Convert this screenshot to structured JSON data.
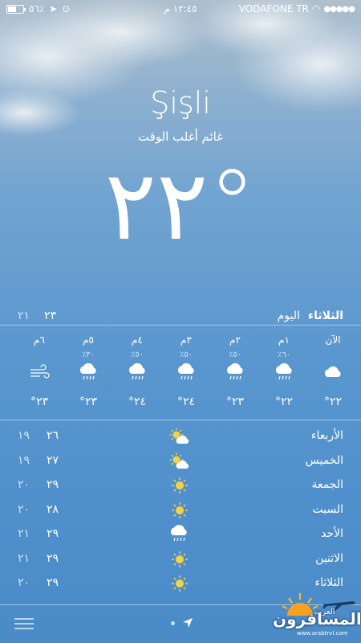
{
  "status_bar": {
    "battery_text": "٥٦٪",
    "battery_level": 0.56,
    "time": "١٢:٤٥ م",
    "carrier": "VODAFONE TR",
    "signal_dots": "●●●●●"
  },
  "location": {
    "city": "Şişli",
    "condition": "غائم أغلب الوقت",
    "temperature": "٢٢°"
  },
  "today": {
    "day": "الثلاثاء",
    "label": "اليوم",
    "high": "٢٣",
    "low": "٢١"
  },
  "hourly": [
    {
      "time": "الآن",
      "pop": "",
      "icon": "cloud-icon",
      "temp": "٢٢°"
    },
    {
      "time": "١م",
      "pop": "٦٠٪",
      "icon": "rain-cloud-icon",
      "temp": "٢٢°"
    },
    {
      "time": "٢م",
      "pop": "٥٠٪",
      "icon": "rain-cloud-icon",
      "temp": "٢٣°"
    },
    {
      "time": "٣م",
      "pop": "٥٠٪",
      "icon": "rain-cloud-icon",
      "temp": "٢٤°"
    },
    {
      "time": "٤م",
      "pop": "٥٠٪",
      "icon": "rain-cloud-icon",
      "temp": "٢٤°"
    },
    {
      "time": "٥م",
      "pop": "٣٠٪",
      "icon": "rain-cloud-icon",
      "temp": "٢٣°"
    },
    {
      "time": "٦م",
      "pop": "",
      "icon": "wind-icon",
      "temp": "٢٣°"
    }
  ],
  "daily": [
    {
      "day": "الأربعاء",
      "icon": "partly-cloudy-icon",
      "high": "٢٦",
      "low": "١٩"
    },
    {
      "day": "الخميس",
      "icon": "partly-cloudy-icon",
      "high": "٢٧",
      "low": "١٩"
    },
    {
      "day": "الجمعة",
      "icon": "sun-icon",
      "high": "٢٩",
      "low": "٢٠"
    },
    {
      "day": "السبت",
      "icon": "sun-icon",
      "high": "٢٨",
      "low": "٢٠"
    },
    {
      "day": "الأحد",
      "icon": "rain-cloud-icon",
      "high": "٢٩",
      "low": "٢١"
    },
    {
      "day": "الاثنين",
      "icon": "sun-icon",
      "high": "٢٩",
      "low": "٢١"
    },
    {
      "day": "الثلاثاء",
      "icon": "sun-icon",
      "high": "٢٩",
      "low": "٢٠"
    }
  ],
  "watermark": {
    "line1": "المسافرون",
    "line2": "العرب",
    "url": "www.arabtrvl.com"
  },
  "colors": {
    "sun": "#f7d23e",
    "cloud": "#ffffff",
    "pop": "#cfe6ff"
  }
}
